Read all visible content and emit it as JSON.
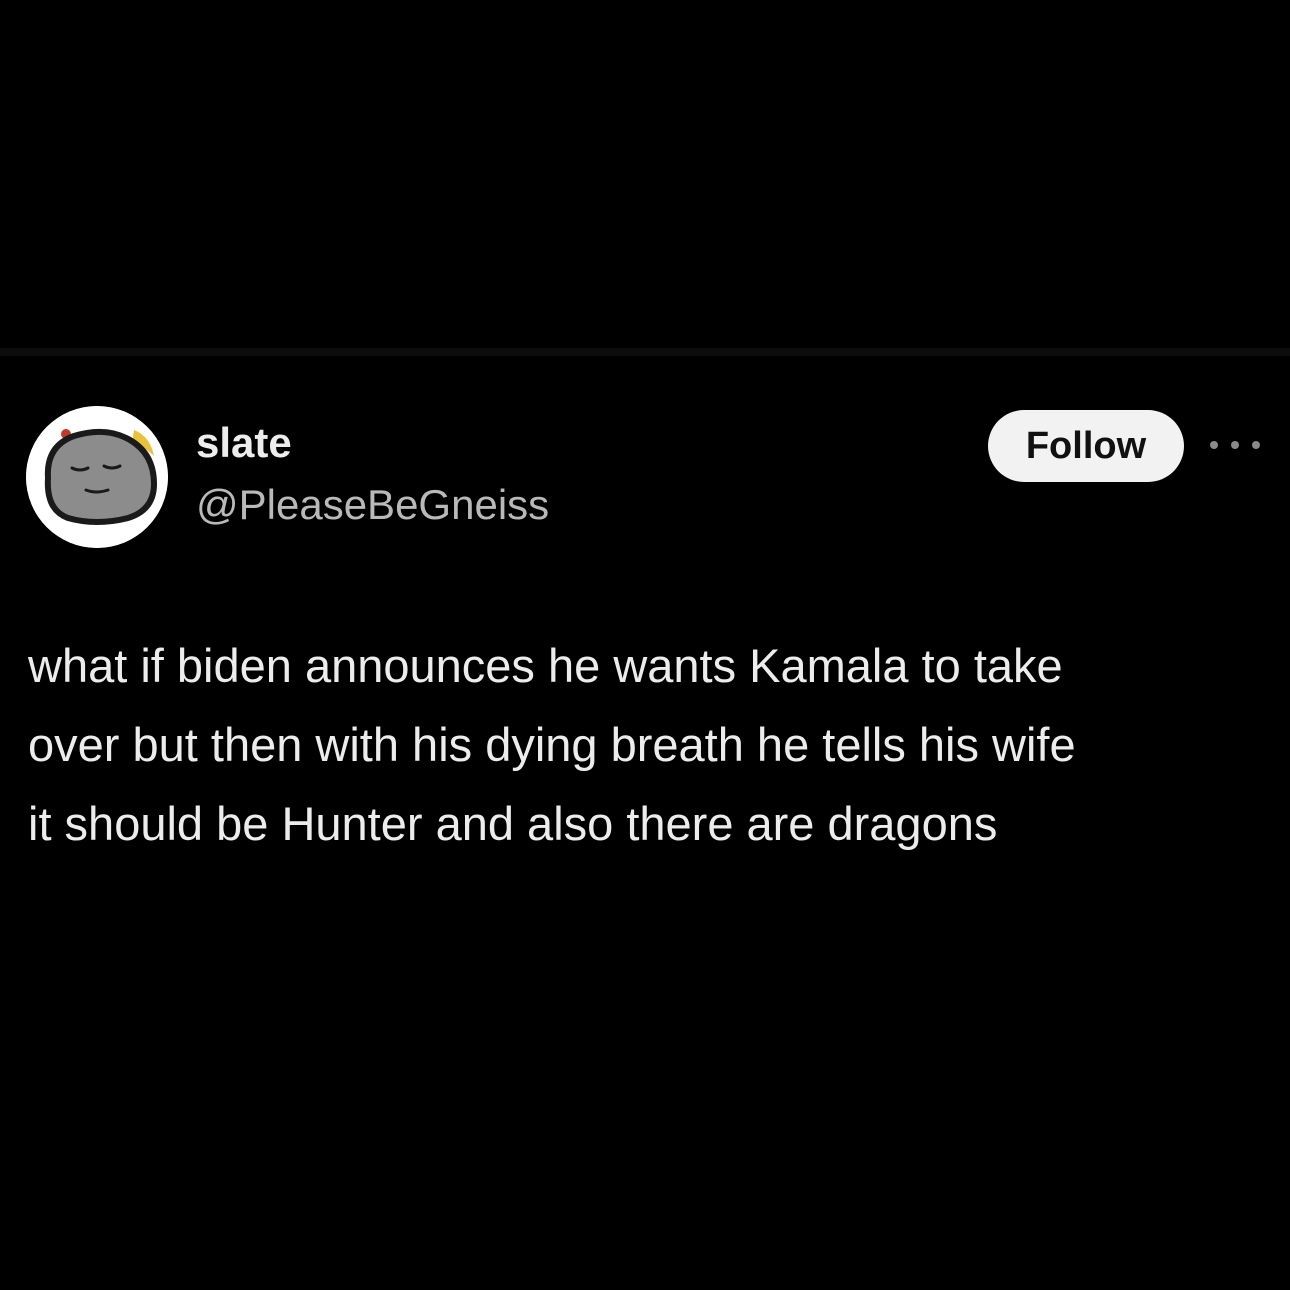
{
  "author": {
    "display_name": "slate",
    "handle": "@PleaseBeGneiss",
    "avatar_icon": "rock-face-avatar"
  },
  "actions": {
    "follow_label": "Follow",
    "more_icon": "more-horizontal-icon"
  },
  "post": {
    "text": "what if biden announces he wants Kamala to take\nover but then with his dying breath he tells his wife\nit should be Hunter and also there are dragons"
  },
  "colors": {
    "background": "#000000",
    "text": "#ececec",
    "secondary_text": "#b9b9b9",
    "button_bg": "#f2f2f2"
  }
}
